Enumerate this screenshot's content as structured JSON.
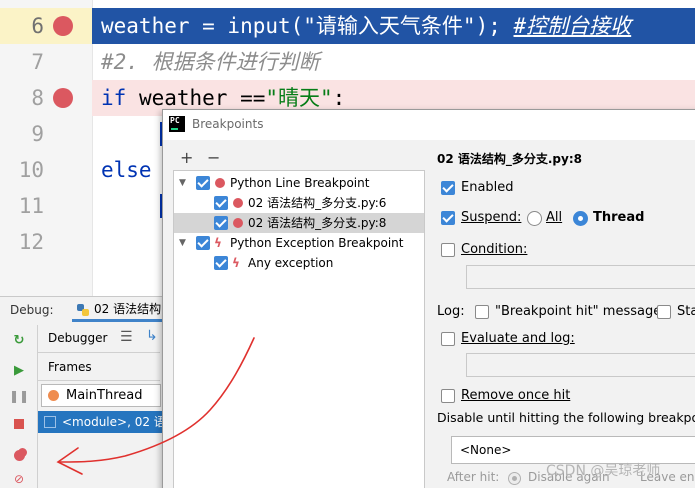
{
  "editor": {
    "lines": [
      {
        "num": "6",
        "code_a": "weather = input(\"请输入天气条件\"); ",
        "comment": "#控制台接收",
        "breakpoint": true,
        "executing": true
      },
      {
        "num": "7",
        "comment": "#2. 根据条件进行判断",
        "breakpoint": false
      },
      {
        "num": "8",
        "kw": "if",
        "code_a": " weather ==",
        "str": "\"晴天\"",
        "code_b": ":",
        "breakpoint": true
      },
      {
        "num": "9"
      },
      {
        "num": "10",
        "kw": "else"
      },
      {
        "num": "11"
      },
      {
        "num": "12"
      }
    ]
  },
  "debug": {
    "label": "Debug:",
    "tab_label": "02 语法结构",
    "debugger_label": "Debugger",
    "frames_label": "Frames",
    "thread": "MainThread",
    "frame": "<module>, 02 语"
  },
  "dialog": {
    "title": "Breakpoints",
    "add": "+",
    "remove": "−",
    "tree": [
      {
        "label": "Python Line Breakpoint",
        "level": 0,
        "kind": "group-line"
      },
      {
        "label": "02 语法结构_多分支.py:6",
        "level": 1,
        "kind": "line"
      },
      {
        "label": "02 语法结构_多分支.py:8",
        "level": 1,
        "kind": "line",
        "selected": true
      },
      {
        "label": "Python Exception Breakpoint",
        "level": 0,
        "kind": "group-exception"
      },
      {
        "label": "Any exception",
        "level": 1,
        "kind": "exception"
      }
    ],
    "props": {
      "title": "02 语法结构_多分支.py:8",
      "enabled": "Enabled",
      "suspend": "Suspend:",
      "all": "All",
      "thread": "Thread",
      "condition": "Condition:",
      "log": "Log:",
      "bp_hit": "\"Breakpoint hit\" message",
      "stack": "Sta",
      "eval_log": "Evaluate and log:",
      "remove_once": "Remove once hit",
      "disable_until": "Disable until hitting the following breakpoint:",
      "none_option": "<None>",
      "after_hit": "After hit:",
      "disable_again": "Disable again",
      "leave_enabled": "Leave ena"
    }
  },
  "watermark": "CSDN @吴琼老师",
  "colors": {
    "accent": "#3c86d7",
    "breakpoint": "#db5860",
    "exec_line": "#2154a5",
    "annotation": "#e0312e"
  }
}
